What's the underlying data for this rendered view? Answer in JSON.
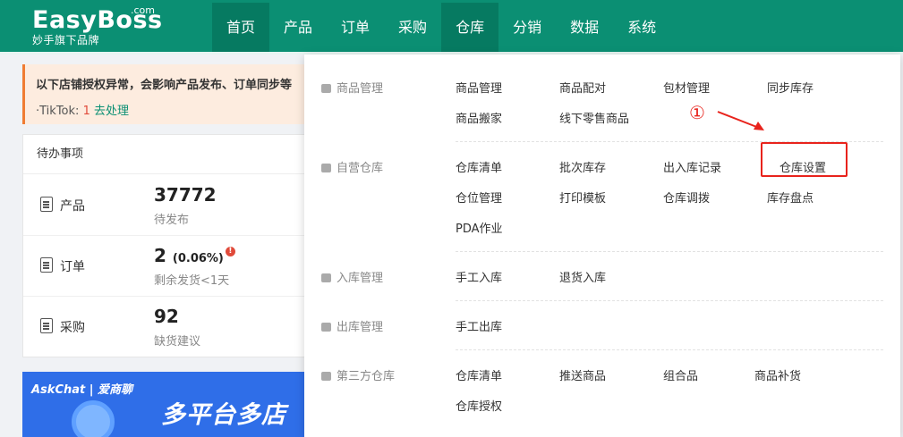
{
  "logo": {
    "main": "EasyBoss",
    "com": ".com",
    "sub": "妙手旗下品牌"
  },
  "nav": [
    "首页",
    "产品",
    "订单",
    "采购",
    "仓库",
    "分销",
    "数据",
    "系统"
  ],
  "alert": {
    "title": "以下店铺授权异常，会影响产品发布、订单同步等",
    "platform": "·TikTok:",
    "count": "1",
    "action": "去处理"
  },
  "todo": {
    "header": "待办事项",
    "rows": [
      {
        "label": "产品",
        "value": "37772",
        "pct": "",
        "sub": "待发布"
      },
      {
        "label": "订单",
        "value": "2",
        "pct": "(0.06%)",
        "sub": "剩余发货<1天"
      },
      {
        "label": "采购",
        "value": "92",
        "pct": "",
        "sub": "缺货建议"
      }
    ]
  },
  "banner": {
    "brand": "AskChat | 爱商聊",
    "big": "多平台多店"
  },
  "dropdown": {
    "categories": [
      {
        "name": "商品管理",
        "items": [
          "商品管理",
          "商品配对",
          "包材管理",
          "同步库存",
          "商品搬家",
          "线下零售商品"
        ]
      },
      {
        "name": "自营仓库",
        "items": [
          "仓库清单",
          "批次库存",
          "出入库记录",
          "仓库设置",
          "仓位管理",
          "打印模板",
          "仓库调拨",
          "库存盘点",
          "PDA作业"
        ]
      },
      {
        "name": "入库管理",
        "items": [
          "手工入库",
          "退货入库"
        ]
      },
      {
        "name": "出库管理",
        "items": [
          "手工出库"
        ]
      },
      {
        "name": "第三方仓库",
        "items": [
          "仓库清单",
          "推送商品",
          "组合品",
          "商品补货",
          "仓库授权"
        ]
      }
    ]
  },
  "annotation": {
    "marker": "①"
  }
}
